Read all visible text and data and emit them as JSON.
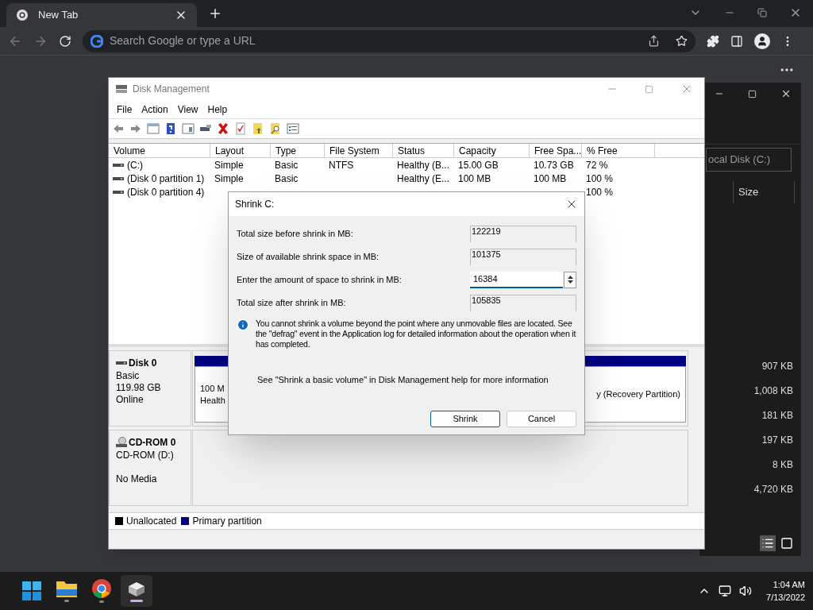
{
  "browser": {
    "tab": {
      "title": "New Tab"
    },
    "omnibox": {
      "placeholder": "Search Google or type a URL"
    }
  },
  "explorer": {
    "address": "ocal Disk (C:)",
    "column": "Size",
    "sizes": [
      "907 KB",
      "1,008 KB",
      "181 KB",
      "197 KB",
      "8 KB",
      "4,720 KB"
    ]
  },
  "disk_management": {
    "title": "Disk Management",
    "menu": [
      "File",
      "Action",
      "View",
      "Help"
    ],
    "columns": [
      "Volume",
      "Layout",
      "Type",
      "File System",
      "Status",
      "Capacity",
      "Free Spa...",
      "% Free"
    ],
    "rows": [
      {
        "cells": [
          "(C:)",
          "Simple",
          "Basic",
          "NTFS",
          "Healthy (B...",
          "15.00 GB",
          "10.73 GB",
          "72 %"
        ]
      },
      {
        "cells": [
          "(Disk 0 partition 1)",
          "Simple",
          "Basic",
          null,
          "Healthy (E...",
          "100 MB",
          "100 MB",
          "100 %"
        ]
      },
      {
        "cells": [
          "(Disk 0 partition 4)",
          null,
          null,
          null,
          null,
          null,
          null,
          "100 %"
        ]
      }
    ],
    "disks": [
      {
        "kind": "disk",
        "name": "Disk 0",
        "lines": [
          "Basic",
          "119.98 GB",
          "Online"
        ],
        "partitions": [
          {
            "lines": [
              "100 M",
              "Health"
            ]
          },
          {
            "lines": [
              "y (Recovery Partition)"
            ]
          }
        ]
      },
      {
        "kind": "cdrom",
        "name": "CD-ROM 0",
        "lines": [
          "CD-ROM (D:)",
          "No Media"
        ]
      }
    ],
    "legend": [
      {
        "label": "Unallocated",
        "color": "#000000"
      },
      {
        "label": "Primary partition",
        "color": "#000080"
      }
    ]
  },
  "dialog": {
    "title": "Shrink C:",
    "fields": [
      {
        "label": "Total size before shrink in MB:",
        "value": "122219",
        "kind": "readonly"
      },
      {
        "label": "Size of available shrink space in MB:",
        "value": "101375",
        "kind": "readonly"
      },
      {
        "label": "Enter the amount of space to shrink in MB:",
        "value": "16384",
        "kind": "spin"
      },
      {
        "label": "Total size after shrink in MB:",
        "value": "105835",
        "kind": "readonly"
      }
    ],
    "info": "You cannot shrink a volume beyond the point where any unmovable files are located. See the \"defrag\" event in the Application log for detailed information about the operation when it has completed.",
    "help": "See \"Shrink a basic volume\" in Disk Management help for more information",
    "buttons": [
      {
        "label": "Shrink",
        "default": true
      },
      {
        "label": "Cancel",
        "default": false
      }
    ]
  },
  "taskbar": {
    "apps": [
      {
        "kind": "start",
        "selected": false
      },
      {
        "kind": "files",
        "selected": false
      },
      {
        "kind": "browser",
        "selected": false
      },
      {
        "kind": "diskmgmt",
        "selected": true
      }
    ],
    "time": "1:04 AM",
    "date": "7/13/2022"
  }
}
